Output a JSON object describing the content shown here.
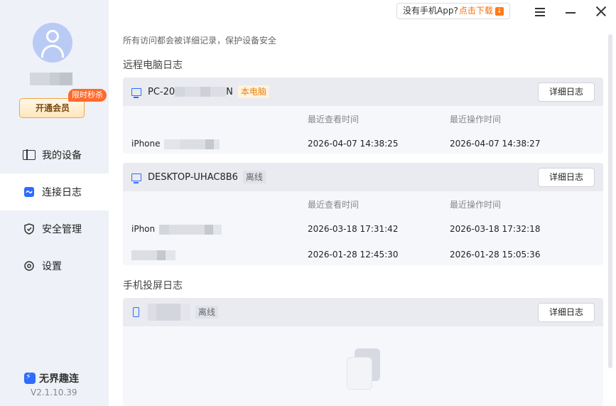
{
  "titlebar": {
    "promo_text": "没有手机App?",
    "promo_link": "点击下载"
  },
  "sidebar": {
    "vip_button": "开通会员",
    "flash_badge": "限时秒杀",
    "nav": [
      {
        "label": "我的设备",
        "icon": "device-icon"
      },
      {
        "label": "连接日志",
        "icon": "log-icon",
        "active": true
      },
      {
        "label": "安全管理",
        "icon": "shield-icon"
      },
      {
        "label": "设置",
        "icon": "gear-icon"
      }
    ],
    "brand": "无界趣连",
    "version": "V2.1.10.39"
  },
  "main": {
    "notice": "所有访问都会被详细记录，保护设备安全",
    "remote_title": "远程电脑日志",
    "mirror_title": "手机投屏日志",
    "col_view": "最近查看时间",
    "col_op": "最近操作时间",
    "detail_label": "详细日志",
    "cards": [
      {
        "device": "PC-20",
        "device_suffix": "N",
        "tag": "本电脑",
        "rows": [
          {
            "client": "iPhone",
            "view": "2026-04-07 14:38:25",
            "op": "2026-04-07 14:38:27"
          }
        ]
      },
      {
        "device": "DESKTOP-UHAC8B6",
        "tag": "离线",
        "rows": [
          {
            "client": "iPhon",
            "view": "2026-03-18 17:31:42",
            "op": "2026-03-18 17:32:18"
          },
          {
            "client": "",
            "view": "2026-01-28 12:45:30",
            "op": "2026-01-28 15:05:36"
          }
        ]
      },
      {
        "device": "",
        "tag": "离线"
      }
    ]
  },
  "colors": {
    "accent": "#2f6bff",
    "vip_orange": "#ff6a2c",
    "sidebar_bg": "#eef1f7"
  }
}
